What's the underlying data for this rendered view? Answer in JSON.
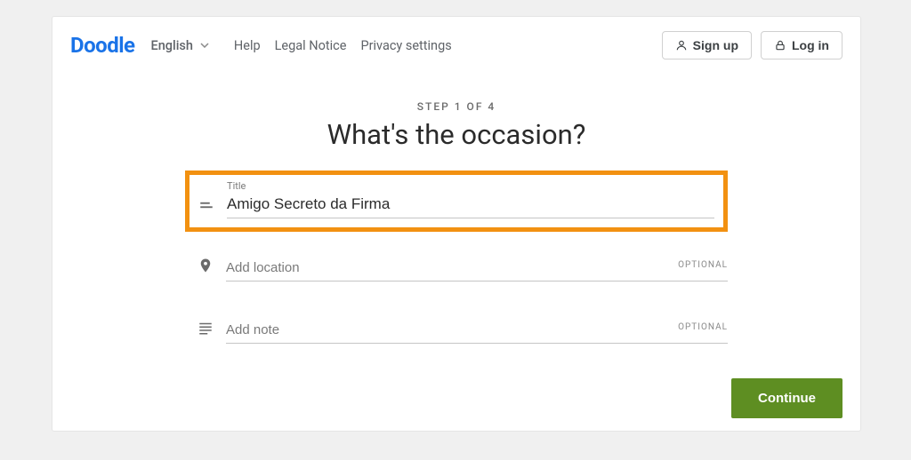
{
  "header": {
    "logo": "Doodle",
    "language": "English",
    "nav": {
      "help": "Help",
      "legal": "Legal Notice",
      "privacy": "Privacy settings"
    },
    "signup": "Sign up",
    "login": "Log in"
  },
  "main": {
    "step": "STEP 1 OF 4",
    "heading": "What's the occasion?"
  },
  "form": {
    "title": {
      "label": "Title",
      "value": "Amigo Secreto da Firma"
    },
    "location": {
      "placeholder": "Add location",
      "optional": "OPTIONAL"
    },
    "note": {
      "placeholder": "Add note",
      "optional": "OPTIONAL"
    }
  },
  "actions": {
    "continue": "Continue"
  }
}
